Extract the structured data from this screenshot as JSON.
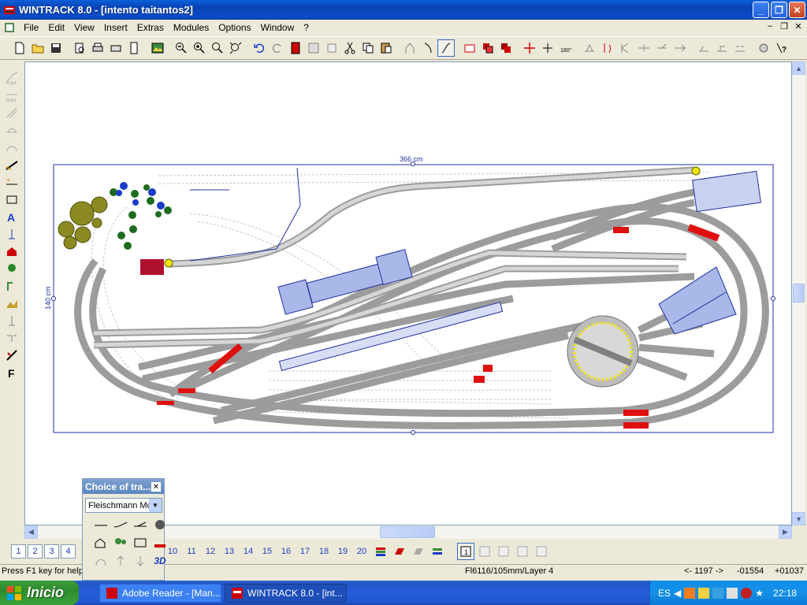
{
  "window": {
    "title": "WINTRACK 8.0 - [intento taitantos2]"
  },
  "menubar": {
    "items": [
      "File",
      "Edit",
      "View",
      "Insert",
      "Extras",
      "Modules",
      "Options",
      "Window",
      "?"
    ]
  },
  "canvas": {
    "width_label": "366 cm",
    "height_label": "140 cm"
  },
  "layers": {
    "selected_buttons": [
      "1",
      "2",
      "3",
      "4"
    ],
    "numbers": [
      "10",
      "11",
      "12",
      "13",
      "14",
      "15",
      "16",
      "17",
      "18",
      "19",
      "20"
    ]
  },
  "choice_panel": {
    "title": "Choice of tra...",
    "selected": "Fleischmann Mc",
    "btn_3d": "3D"
  },
  "status": {
    "help": "Press F1 key for help",
    "track_info": "Fl6116/105mm/Layer 4",
    "pos1": "<- 1197 ->",
    "pos2": "-01554",
    "pos3": "+01037"
  },
  "taskbar": {
    "start": "Inicio",
    "tasks": [
      "Adobe Reader - [Man...",
      "WINTRACK 8.0 - [int..."
    ],
    "lang": "ES",
    "time": "22:18"
  },
  "colors": {
    "track": "#BDBDBD",
    "building": "#A9B8E8",
    "red": "#E01010",
    "yellow": "#F5E600",
    "tree_dark": "#1E6B20",
    "tree_olive": "#8A8A20",
    "blue_tree": "#1A3CC8"
  }
}
